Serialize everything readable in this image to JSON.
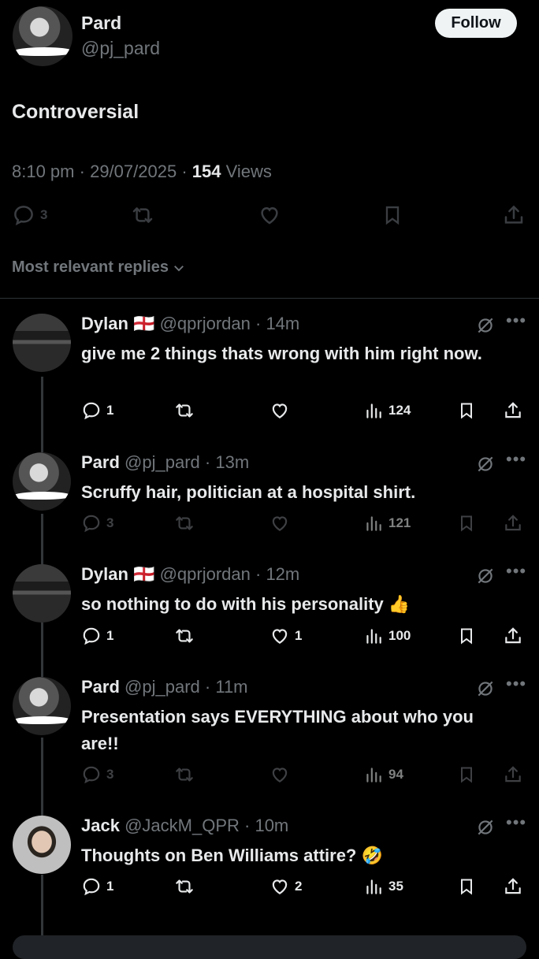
{
  "post": {
    "author_name": "Pard",
    "author_handle": "@pj_pard",
    "follow_label": "Follow",
    "text": "Controversial",
    "time": "8:10 pm",
    "date": "29/07/2025",
    "views_count": "154",
    "views_label": "Views",
    "reply_count": "3"
  },
  "replies_header": "Most relevant replies",
  "replies": [
    {
      "name": "Dylan",
      "flag": "🏴󠁧󠁢󠁥󠁮󠁧󠁿",
      "handle": "@qprjordan",
      "time": "14m",
      "text": "give me 2 things thats wrong with him right now.",
      "reply_count": "1",
      "like_count": "",
      "views": "124"
    },
    {
      "name": "Pard",
      "flag": "",
      "handle": "@pj_pard",
      "time": "13m",
      "text": "Scruffy hair, politician at a hospital shirt.",
      "reply_count": "3",
      "like_count": "",
      "views": "121"
    },
    {
      "name": "Dylan",
      "flag": "🏴󠁧󠁢󠁥󠁮󠁧󠁿",
      "handle": "@qprjordan",
      "time": "12m",
      "text": "so nothing to do with his personality 👍",
      "reply_count": "1",
      "like_count": "1",
      "views": "100"
    },
    {
      "name": "Pard",
      "flag": "",
      "handle": "@pj_pard",
      "time": "11m",
      "text": "Presentation says EVERYTHING about who you are!!",
      "reply_count": "3",
      "like_count": "",
      "views": "94"
    },
    {
      "name": "Jack",
      "flag": "",
      "handle": "@JackM_QPR",
      "time": "10m",
      "text": "Thoughts on Ben Williams attire? 🤣",
      "reply_count": "1",
      "like_count": "2",
      "views": "35"
    }
  ],
  "icons": {
    "reply": "speech-bubble-icon",
    "repost": "repost-icon",
    "like": "heart-icon",
    "views": "bar-chart-icon",
    "bookmark": "bookmark-icon",
    "share": "share-icon",
    "grok": "grok-icon",
    "more": "more-icon"
  },
  "colors": {
    "background": "#000000",
    "text": "#e7e9ea",
    "secondary": "#71767b",
    "follow_bg": "#eff3f4"
  }
}
